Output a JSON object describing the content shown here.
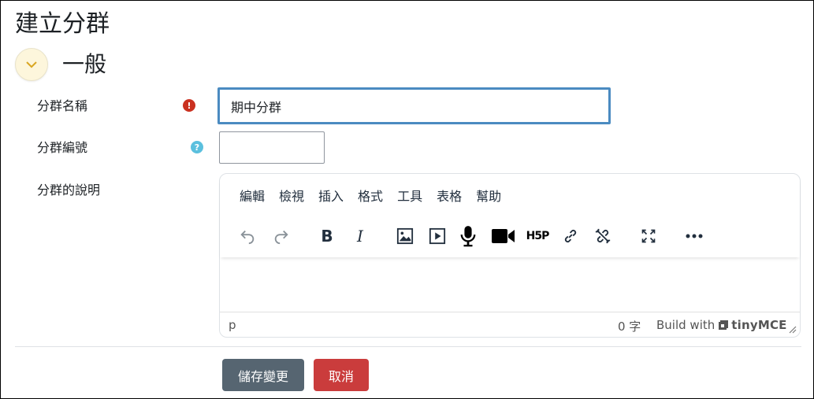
{
  "page": {
    "title": "建立分群"
  },
  "section": {
    "title": "一般"
  },
  "form": {
    "name_label": "分群名稱",
    "name_value": "期中分群",
    "id_label": "分群編號",
    "id_value": "",
    "desc_label": "分群的說明",
    "required_badge": "!",
    "help_badge": "?"
  },
  "editor": {
    "menu": [
      "編輯",
      "檢視",
      "插入",
      "格式",
      "工具",
      "表格",
      "幫助"
    ],
    "toolbar": [
      "undo-icon",
      "redo-icon",
      "bold-icon",
      "italic-icon",
      "image-icon",
      "media-icon",
      "microphone-icon",
      "video-icon",
      "h5p-icon",
      "link-icon",
      "unlink-icon",
      "fullscreen-icon",
      "more-icon"
    ],
    "h5p_label": "H5P",
    "bold_label": "B",
    "italic_label": "I",
    "status_path": "p",
    "word_count": "0 字",
    "branding": "Build with",
    "brand_name": "tinyMCE"
  },
  "actions": {
    "save": "儲存變更",
    "cancel": "取消"
  },
  "colors": {
    "accent": "#4b8bc1",
    "required": "#ca3120",
    "help": "#5bc0de",
    "save": "#566571",
    "cancel": "#ca3c3c"
  }
}
